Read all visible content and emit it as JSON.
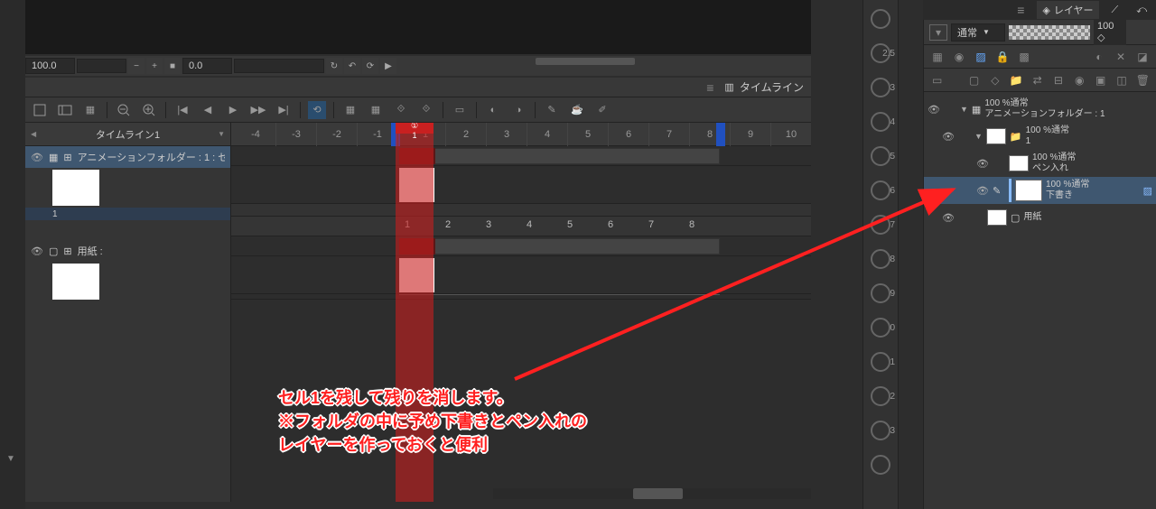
{
  "topControls": {
    "zoom": "100.0",
    "position": "0.0"
  },
  "timeline": {
    "panelTitle": "タイムライン",
    "selector": "タイムライン1",
    "rulerNums": [
      "-4",
      "-3",
      "-2",
      "-1",
      "1",
      "2",
      "3",
      "4",
      "5",
      "6",
      "7",
      "8",
      "9",
      "10"
    ],
    "playheadFrame": "①\n1",
    "tracks": [
      {
        "name": "アニメーションフォルダー : 1 : セ",
        "index": "1"
      },
      {
        "name": "用紙 :"
      }
    ],
    "frameNums": [
      "1",
      "2",
      "3",
      "4",
      "5",
      "6",
      "7",
      "8"
    ]
  },
  "markers": [
    "2.5",
    "3",
    "4",
    "5",
    "6",
    "7",
    "8",
    "9",
    "0",
    "1",
    "2",
    "3"
  ],
  "layers": {
    "panelTitle": "レイヤー",
    "blendMode": "通常",
    "opacity": "100",
    "items": [
      {
        "line1": "100 %通常",
        "line2": "アニメーションフォルダー : 1",
        "indent": 0,
        "type": "folder"
      },
      {
        "line1": "100 %通常",
        "line2": "1",
        "indent": 1,
        "type": "folder"
      },
      {
        "line1": "100 %通常",
        "line2": "ペン入れ",
        "indent": 2,
        "type": "layer"
      },
      {
        "line1": "100 %通常",
        "line2": "下書き",
        "indent": 2,
        "type": "layer",
        "selected": true
      },
      {
        "line1": "",
        "line2": "用紙",
        "indent": 1,
        "type": "paper"
      }
    ]
  },
  "annotation": {
    "line1": "セル1を残して残りを消します。",
    "line2": "※フォルダの中に予め下書きとペン入れの",
    "line3": "レイヤーを作っておくと便利"
  }
}
